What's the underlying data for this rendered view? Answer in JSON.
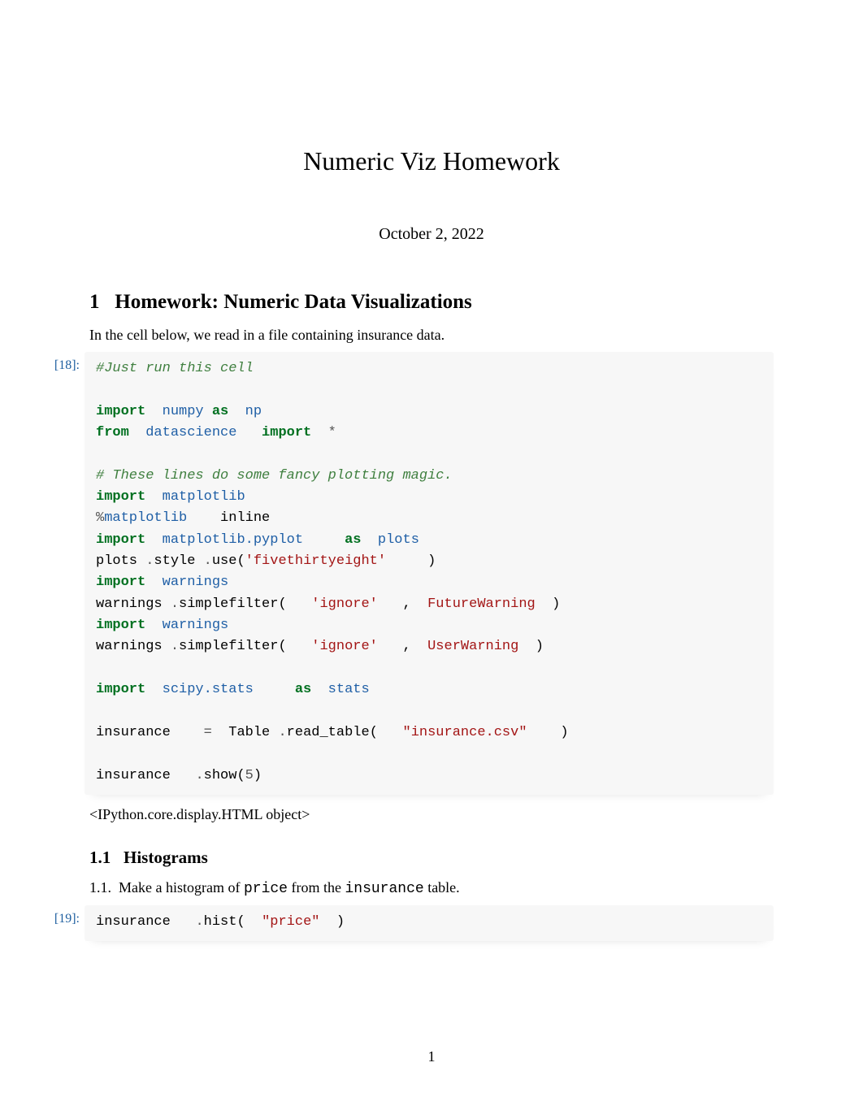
{
  "title": "Numeric Viz Homework",
  "date": "October 2, 2022",
  "section1": {
    "number": "1",
    "heading": "Homework: Numeric Data Visualizations",
    "intro": "In the cell below, we read in a file containing insurance data."
  },
  "cell1": {
    "prompt": "[18]:",
    "code": {
      "c1": "#Just run this cell",
      "kw_import1": "import",
      "mod_numpy": "numpy",
      "kw_as1": "as",
      "alias_np": "np",
      "kw_from": "from",
      "mod_datascience": "datascience",
      "kw_import2": "import",
      "star": "*",
      "c2": "# These lines do some fancy plotting magic.",
      "kw_import3": "import",
      "mod_matplotlib": "matplotlib",
      "magic_pct": "%",
      "magic_matplotlib": "matplotlib",
      "magic_inline": "inline",
      "kw_import4": "import",
      "mod_mpl_pyplot": "matplotlib.pyplot",
      "kw_as2": "as",
      "alias_plots": "plots",
      "plots_var": "plots",
      "dot1": ".",
      "style_attr": "style",
      "dot2": ".",
      "use_fn": "use(",
      "style_str": "'fivethirtyeight'",
      "close1": ")",
      "kw_import5": "import",
      "mod_warnings1": "warnings",
      "warnings_var1": "warnings",
      "dot3": ".",
      "sf1": "simplefilter(",
      "ignore1": "'ignore'",
      "comma1": ",",
      "fw": "FutureWarning",
      "close2": ")",
      "kw_import6": "import",
      "mod_warnings2": "warnings",
      "warnings_var2": "warnings",
      "dot4": ".",
      "sf2": "simplefilter(",
      "ignore2": "'ignore'",
      "comma2": ",",
      "uw": "UserWarning",
      "close3": ")",
      "kw_import7": "import",
      "mod_scipy": "scipy.stats",
      "kw_as3": "as",
      "alias_stats": "stats",
      "ins_var": "insurance",
      "eq": "=",
      "table": "Table",
      "dot5": ".",
      "rt": "read_table(",
      "csv_str": "\"insurance.csv\"",
      "close4": ")",
      "ins_var2": "insurance",
      "dot6": ".",
      "show_fn": "show(",
      "five": "5",
      "close5": ")"
    },
    "output": "<IPython.core.display.HTML object>"
  },
  "subsection11": {
    "number": "1.1",
    "heading": "Histograms",
    "task_prefix": "1.1.",
    "task_a": "Make a histogram of",
    "task_code1": "price",
    "task_b": "from the",
    "task_code2": "insurance",
    "task_c": "table."
  },
  "cell2": {
    "prompt": "[19]:",
    "code": {
      "ins_var": "insurance",
      "dot": ".",
      "hist_fn": "hist(",
      "price_str": "\"price\"",
      "close": ")"
    }
  },
  "page_number": "1"
}
